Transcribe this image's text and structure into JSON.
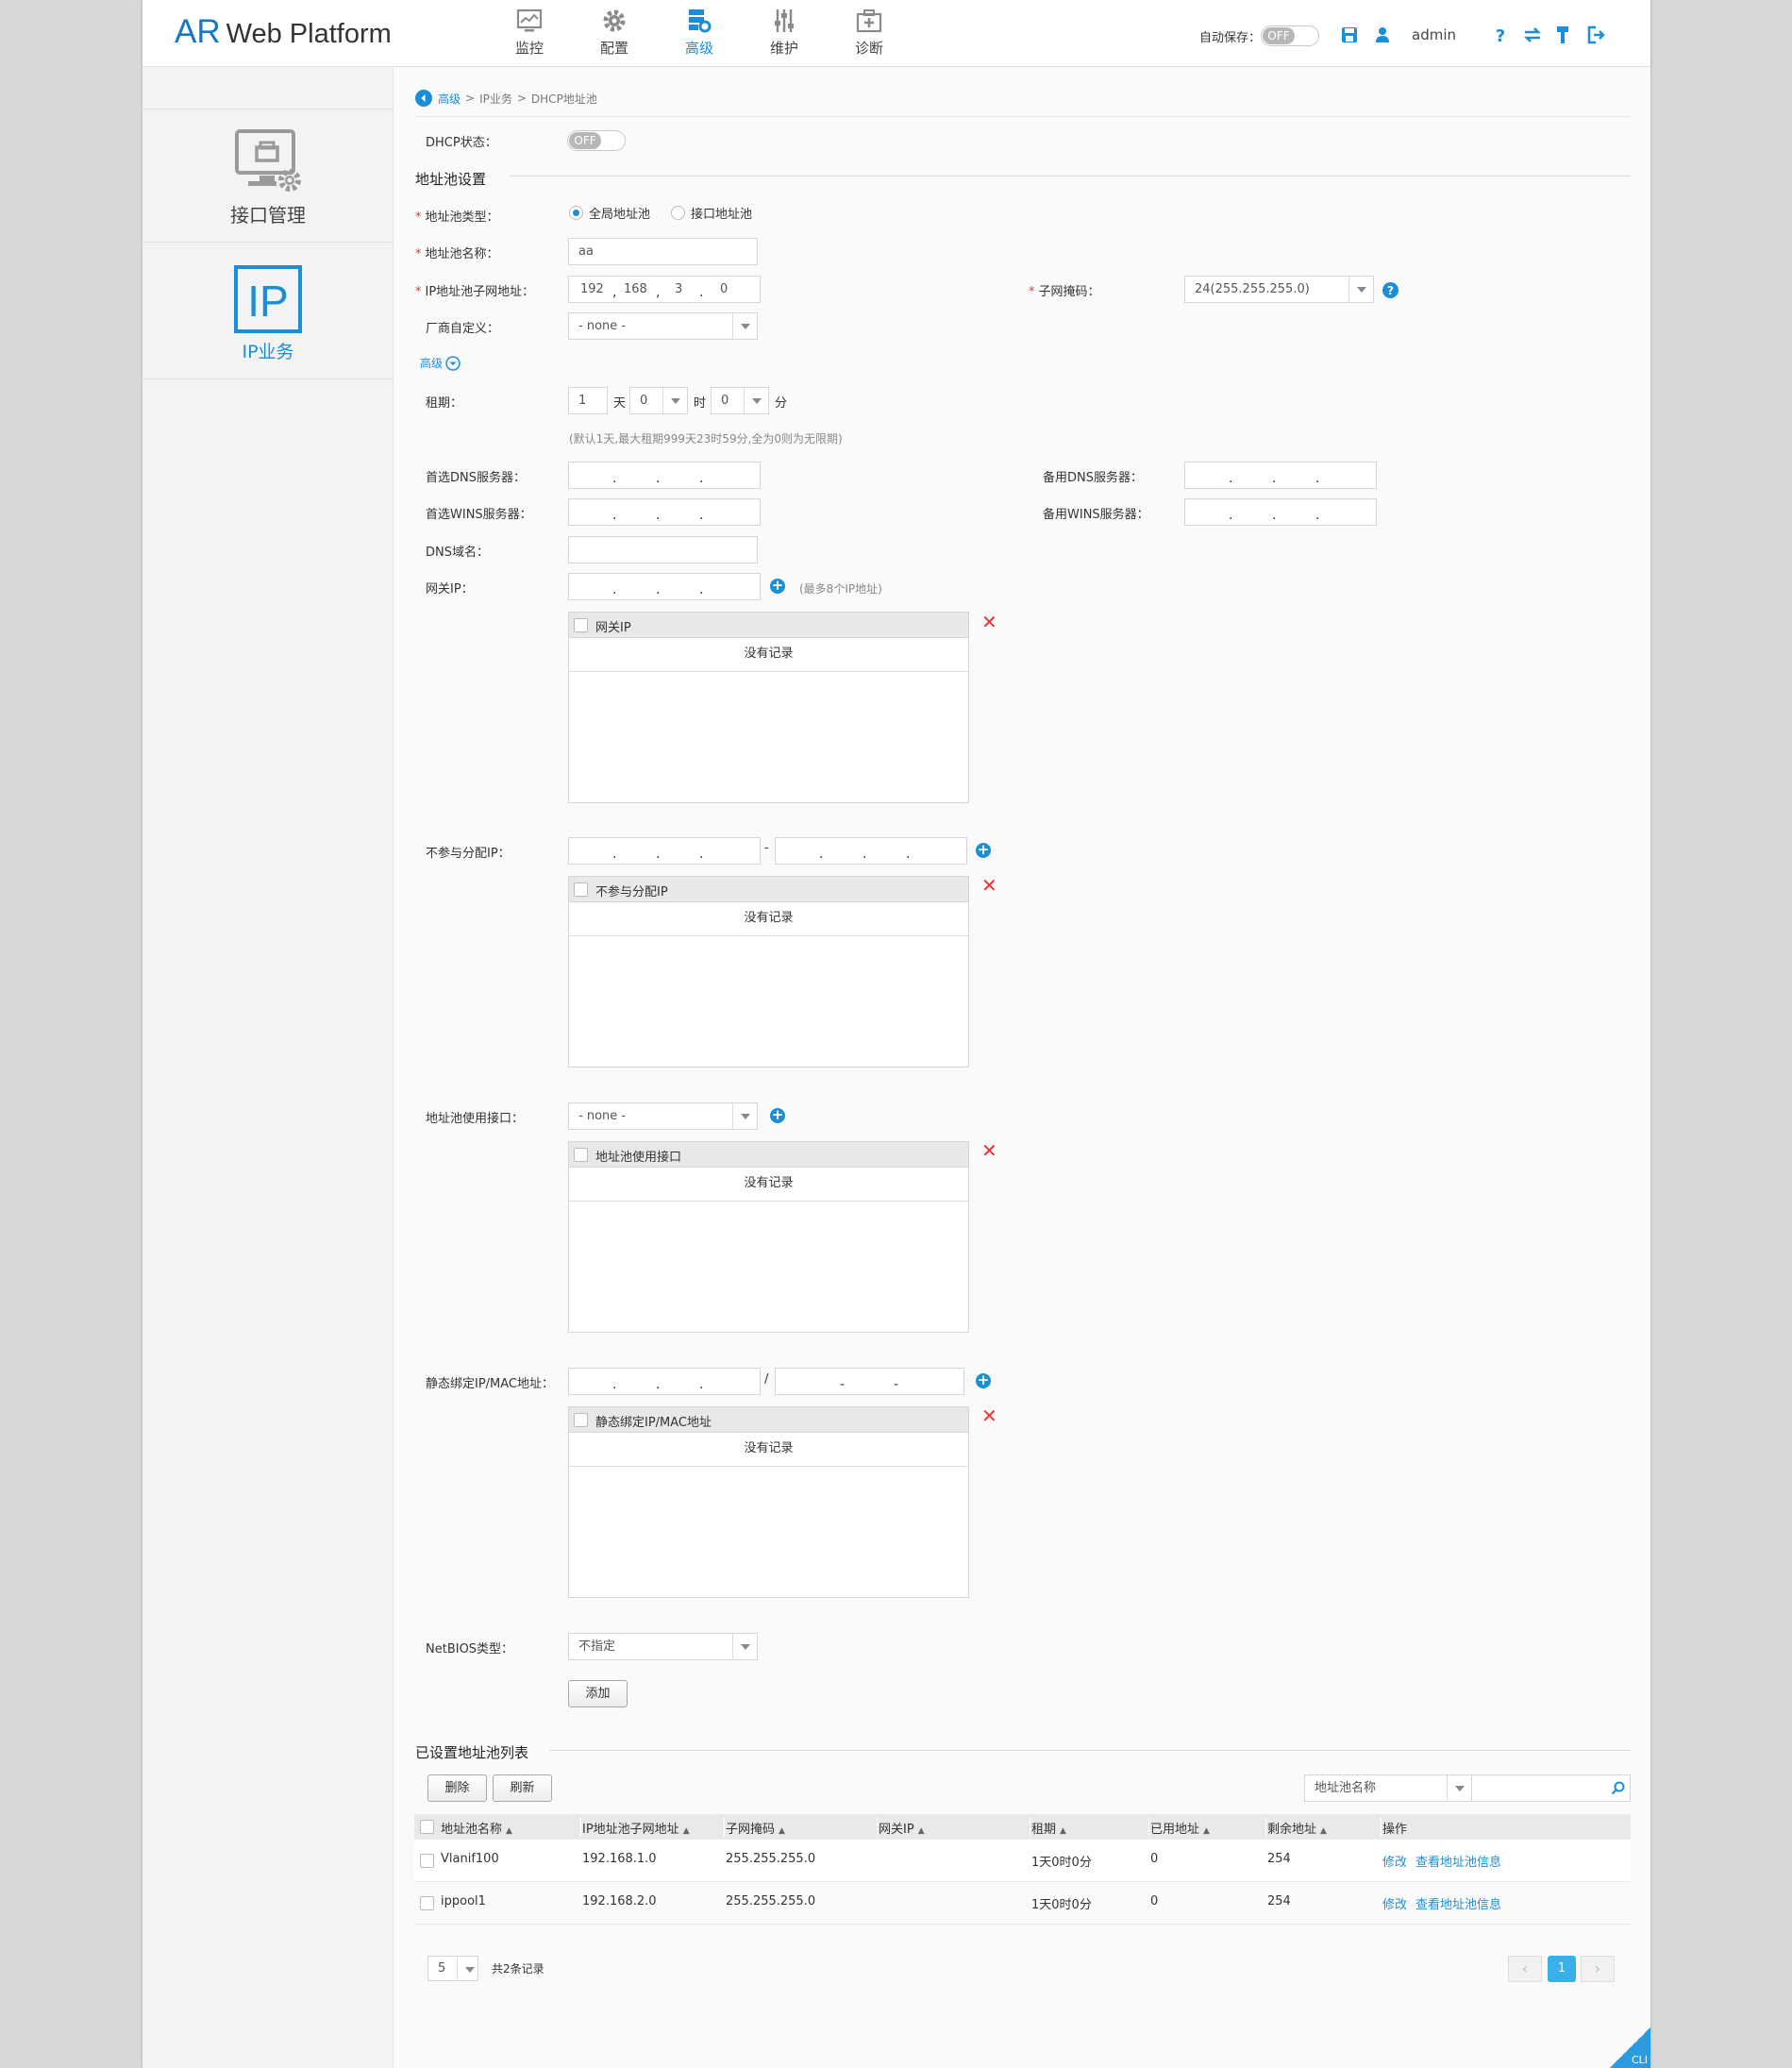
{
  "app": {
    "brand_ar": "AR",
    "brand_rest": "Web Platform"
  },
  "nav": [
    {
      "label": "监控",
      "icon": "monitor-icon"
    },
    {
      "label": "配置",
      "icon": "gear-icon"
    },
    {
      "label": "高级",
      "icon": "advanced-icon",
      "active": true
    },
    {
      "label": "维护",
      "icon": "maintain-icon"
    },
    {
      "label": "诊断",
      "icon": "diagnose-icon"
    }
  ],
  "header_right": {
    "autosave_label": "自动保存：",
    "autosave_state": "OFF",
    "user": "admin"
  },
  "sidebar": [
    {
      "label": "接口管理",
      "icon": "interface-mgmt-icon"
    },
    {
      "label": "IP业务",
      "icon": "ip-icon",
      "active": true
    }
  ],
  "breadcrumb": {
    "l1": "高级",
    "sep": ">",
    "l2": "IP业务",
    "l3": "DHCP地址池"
  },
  "dhcp": {
    "label": "DHCP状态：",
    "state": "OFF"
  },
  "pool_settings": {
    "title": "地址池设置",
    "pool_type_label": "地址池类型：",
    "pool_type_options": [
      "全局地址池",
      "接口地址池"
    ],
    "pool_name_label": "地址池名称：",
    "pool_name_value": "aa",
    "subnet_label": "IP地址池子网地址：",
    "subnet_octets": [
      "192",
      "168",
      "3",
      "0"
    ],
    "mask_label": "子网掩码：",
    "mask_value": "24(255.255.255.0)",
    "vendor_label": "厂商自定义：",
    "vendor_value": "- none -",
    "advanced_label": "高级",
    "lease_label": "租期：",
    "lease_day": "1",
    "lease_day_unit": "天",
    "lease_hour": "0",
    "lease_hour_unit": "时",
    "lease_min": "0",
    "lease_min_unit": "分",
    "lease_hint": "(默认1天,最大租期999天23时59分,全为0则为无限期)",
    "dns1_label": "首选DNS服务器：",
    "dns2_label": "备用DNS服务器：",
    "wins1_label": "首选WINS服务器：",
    "wins2_label": "备用WINS服务器：",
    "domain_label": "DNS域名：",
    "gateway_label": "网关IP：",
    "gateway_hint": "(最多8个IP地址)",
    "gateway_table_header": "网关IP",
    "excluded_label": "不参与分配IP：",
    "excluded_dash": "-",
    "excluded_table_header": "不参与分配IP",
    "iface_label": "地址池使用接口：",
    "iface_value": "- none -",
    "iface_table_header": "地址池使用接口",
    "static_label": "静态绑定IP/MAC地址：",
    "static_slash": "/",
    "static_table_header": "静态绑定IP/MAC地址",
    "no_record": "没有记录",
    "netbios_label": "NetBIOS类型：",
    "netbios_value": "不指定",
    "add_button": "添加"
  },
  "list": {
    "title": "已设置地址池列表",
    "delete_button": "删除",
    "refresh_button": "刷新",
    "search_field": "地址池名称",
    "columns": [
      "地址池名称",
      "IP地址池子网地址",
      "子网掩码",
      "网关IP",
      "租期",
      "已用地址",
      "剩余地址",
      "操作"
    ],
    "rows": [
      {
        "name": "Vlanif100",
        "subnet": "192.168.1.0",
        "mask": "255.255.255.0",
        "gateway": "",
        "lease": "1天0时0分",
        "used": "0",
        "remain": "254",
        "edit": "修改",
        "view": "查看地址池信息"
      },
      {
        "name": "ippool1",
        "subnet": "192.168.2.0",
        "mask": "255.255.255.0",
        "gateway": "",
        "lease": "1天0时0分",
        "used": "0",
        "remain": "254",
        "edit": "修改",
        "view": "查看地址池信息"
      }
    ],
    "page_size": "5",
    "total": "共2条记录",
    "current_page": "1"
  },
  "cli": "CLI",
  "colors": {
    "accent": "#1a8fd8",
    "danger": "#e33333",
    "sidebar_bg": "#f3f3f3"
  }
}
